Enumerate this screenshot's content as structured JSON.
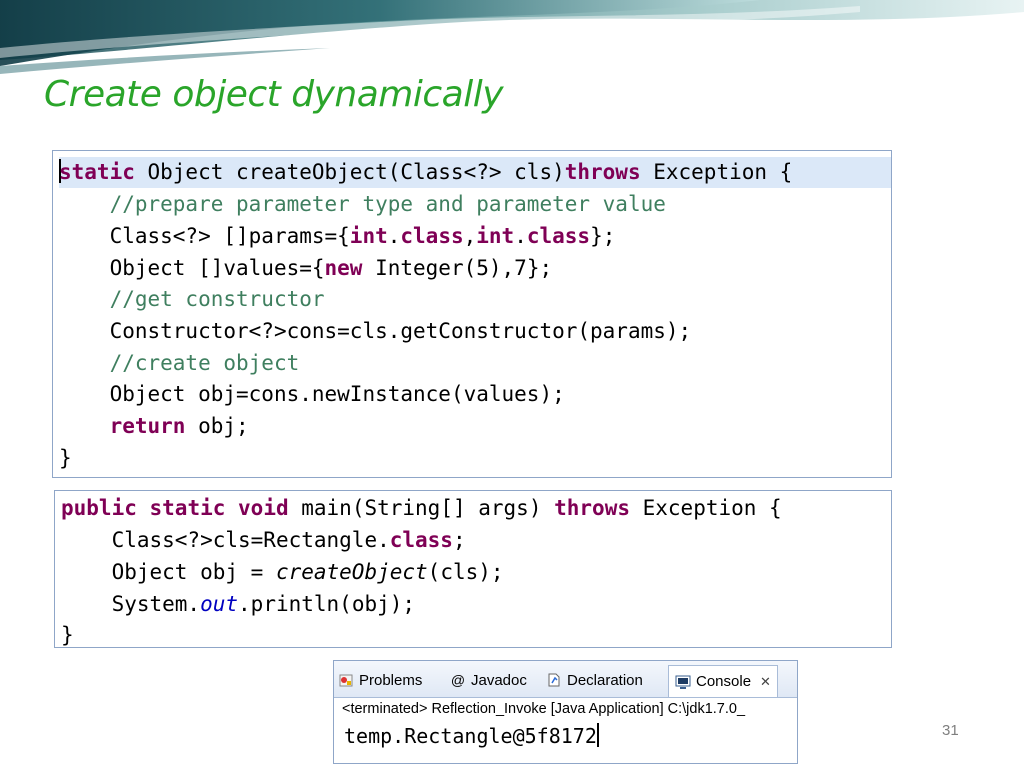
{
  "slide": {
    "title": "Create object dynamically",
    "page_number": "31"
  },
  "code_create": {
    "l1_kw": "static",
    "l1_a": " Object createObject(Class<?> cls)",
    "l1_kw2": "throws",
    "l1_b": " Exception {",
    "l2": "//prepare parameter type and parameter value",
    "l3_a": "Class<?> []params={",
    "l3_kw1": "int",
    "l3_b": ".",
    "l3_kw2": "class",
    "l3_c": ",",
    "l3_kw3": "int",
    "l3_d": ".",
    "l3_kw4": "class",
    "l3_e": "};",
    "l4_a": "Object []values={",
    "l4_kw": "new",
    "l4_b": " Integer(5),7};",
    "l5": "//get constructor",
    "l6": "Constructor<?>cons=cls.getConstructor(params);",
    "l7": "//create object",
    "l8": "Object obj=cons.newInstance(values);",
    "l9_kw": "return",
    "l9_b": " obj;",
    "l10": "}"
  },
  "code_main": {
    "l1_kw1": "public",
    "l1_kw2": "static",
    "l1_kw3": "void",
    "l1_a": " main(String[] args) ",
    "l1_kw4": "throws",
    "l1_b": " Exception {",
    "l2_a": "Class<?>cls=Rectangle.",
    "l2_kw": "class",
    "l2_b": ";",
    "l3_a": "Object obj = ",
    "l3_it": "createObject",
    "l3_b": "(cls);",
    "l4_a": "System.",
    "l4_fld": "out",
    "l4_b": ".println(obj);",
    "l5": "}"
  },
  "console": {
    "tabs": [
      {
        "label": "Problems",
        "icon": "problems-icon"
      },
      {
        "label": "Javadoc",
        "icon": "javadoc-icon"
      },
      {
        "label": "Declaration",
        "icon": "declaration-icon"
      },
      {
        "label": "Console",
        "icon": "console-icon"
      }
    ],
    "close_glyph": "✕",
    "status": "<terminated> Reflection_Invoke [Java Application] C:\\jdk1.7.0_",
    "output": "temp.Rectangle@5f8172"
  }
}
